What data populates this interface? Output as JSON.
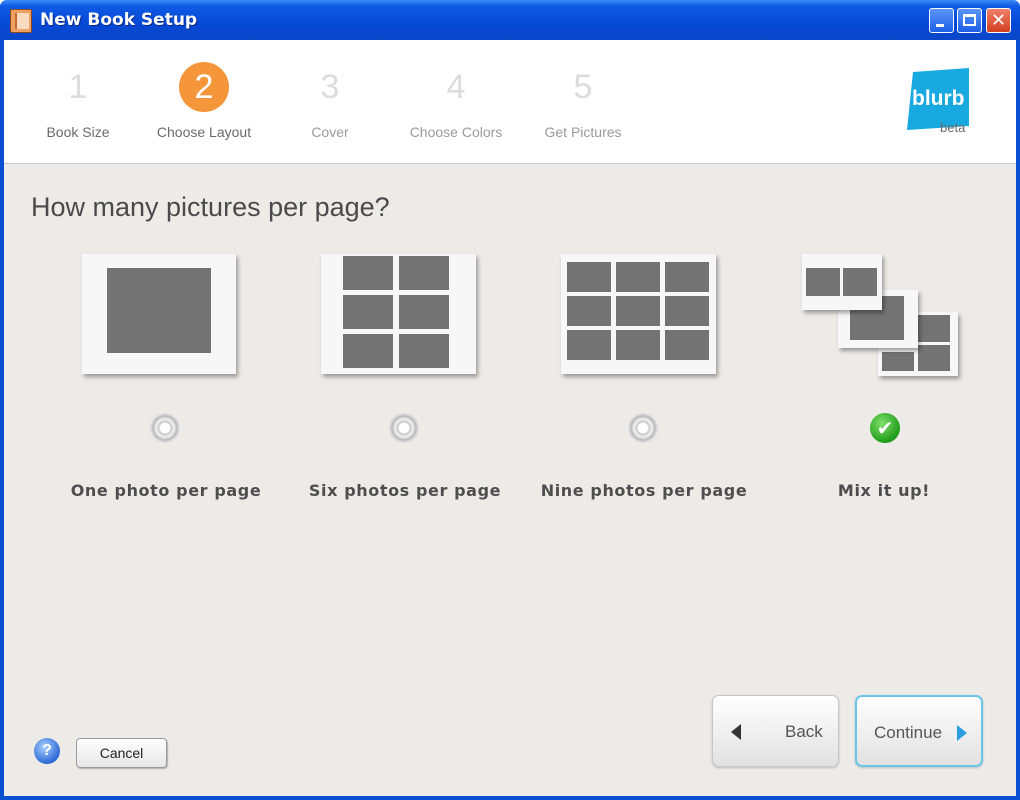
{
  "window": {
    "title": "New Book Setup"
  },
  "steps": [
    {
      "number": "1",
      "label": "Book Size"
    },
    {
      "number": "2",
      "label": "Choose Layout"
    },
    {
      "number": "3",
      "label": "Cover"
    },
    {
      "number": "4",
      "label": "Choose Colors"
    },
    {
      "number": "5",
      "label": "Get Pictures"
    }
  ],
  "active_step": "2",
  "brand": {
    "logo_text": "blurb",
    "badge": "beta",
    "color": "#18a9e0"
  },
  "question": "How many pictures per page?",
  "options": [
    {
      "label": "One photo per page",
      "selected": false
    },
    {
      "label": "Six photos per page",
      "selected": false
    },
    {
      "label": "Nine photos per page",
      "selected": false
    },
    {
      "label": "Mix it up!",
      "selected": true
    }
  ],
  "buttons": {
    "back": "Back",
    "continue": "Continue",
    "cancel": "Cancel",
    "help": "?"
  },
  "colors": {
    "accent_orange": "#f5963a",
    "continue_border": "#69c6e8",
    "check_green": "#1f9c1a"
  }
}
